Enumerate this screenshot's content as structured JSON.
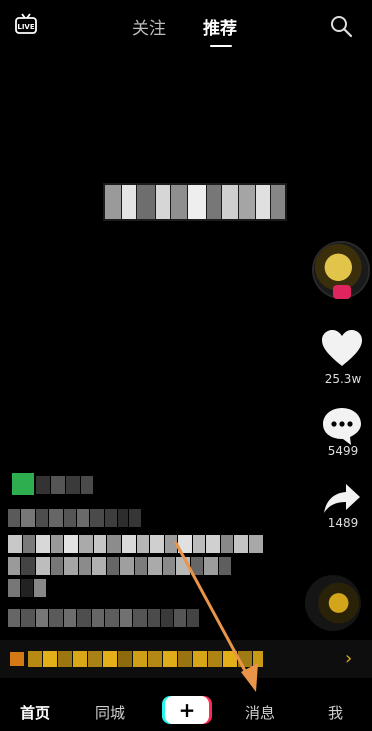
{
  "header": {
    "tabs": [
      {
        "label": "关注"
      },
      {
        "label": "推荐"
      }
    ]
  },
  "sidebar": {
    "like_count": "25.3w",
    "comment_count": "5499",
    "share_count": "1489"
  },
  "promo": {
    "chevron": "›"
  },
  "bottom_nav": {
    "home": "首页",
    "city": "同城",
    "create": "+",
    "messages": "消息",
    "me": "我"
  },
  "colors": {
    "background": "#000000",
    "accent_red": "#fe2c55",
    "accent_cyan": "#25f4ee",
    "arrow": "#e8954a",
    "promo": "#e3b01a"
  },
  "icons": [
    "live-icon",
    "search-icon",
    "heart-icon",
    "comment-icon",
    "share-icon",
    "music-disc-icon"
  ]
}
